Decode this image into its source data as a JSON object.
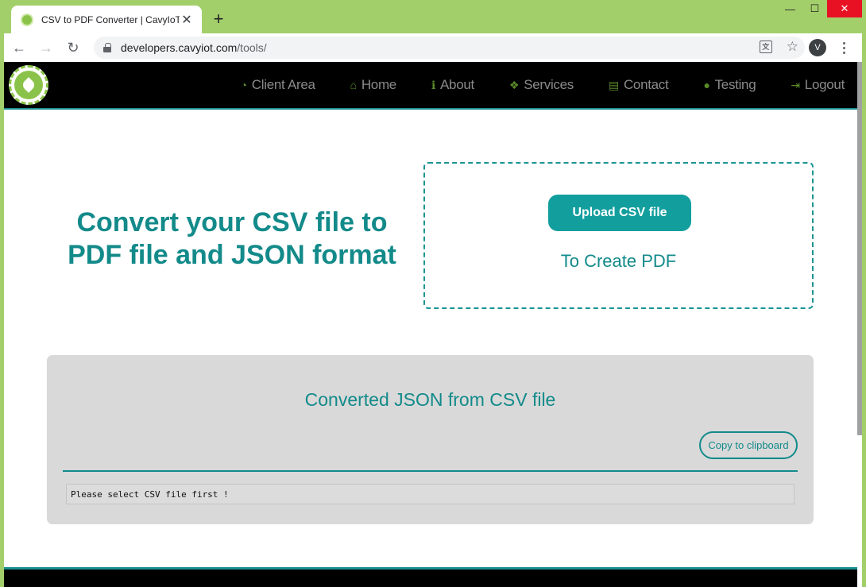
{
  "browser": {
    "tab_title": "CSV to PDF Converter | CavyIoT",
    "tab_close": "✕",
    "new_tab": "+",
    "url_host": "developers.cavyiot.com",
    "url_path": "/tools/",
    "profile_initial": "V",
    "window_controls": {
      "minimize": "—",
      "maximize": "☐",
      "close": "✕"
    }
  },
  "site": {
    "nav": [
      {
        "label": "Client Area",
        "icon": "dashboard-icon",
        "glyph": "◔"
      },
      {
        "label": "Home",
        "icon": "home-icon",
        "glyph": "⌂"
      },
      {
        "label": "About",
        "icon": "info-icon",
        "glyph": "ℹ"
      },
      {
        "label": "Services",
        "icon": "cubes-icon",
        "glyph": "❖"
      },
      {
        "label": "Contact",
        "icon": "id-card-icon",
        "glyph": "▤"
      },
      {
        "label": "Testing",
        "icon": "user-icon",
        "glyph": "●"
      },
      {
        "label": "Logout",
        "icon": "sign-out-icon",
        "glyph": "⇥"
      }
    ],
    "accent": "#138a8a"
  },
  "hero": {
    "title": "Convert your CSV file to PDF file and JSON format",
    "upload_label": "Upload CSV file",
    "upload_sub": "To Create PDF"
  },
  "json_panel": {
    "title": "Converted JSON from CSV file",
    "copy_label": "Copy to clipboard",
    "output": "Please select CSV file first !"
  }
}
